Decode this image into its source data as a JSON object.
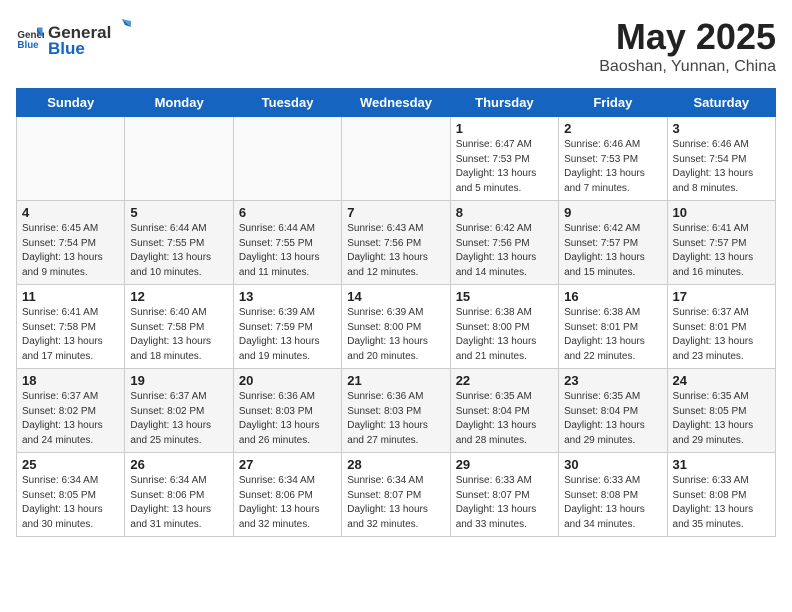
{
  "header": {
    "logo_general": "General",
    "logo_blue": "Blue",
    "month": "May 2025",
    "location": "Baoshan, Yunnan, China"
  },
  "weekdays": [
    "Sunday",
    "Monday",
    "Tuesday",
    "Wednesday",
    "Thursday",
    "Friday",
    "Saturday"
  ],
  "weeks": [
    [
      {
        "day": "",
        "info": ""
      },
      {
        "day": "",
        "info": ""
      },
      {
        "day": "",
        "info": ""
      },
      {
        "day": "",
        "info": ""
      },
      {
        "day": "1",
        "info": "Sunrise: 6:47 AM\nSunset: 7:53 PM\nDaylight: 13 hours and 5 minutes."
      },
      {
        "day": "2",
        "info": "Sunrise: 6:46 AM\nSunset: 7:53 PM\nDaylight: 13 hours and 7 minutes."
      },
      {
        "day": "3",
        "info": "Sunrise: 6:46 AM\nSunset: 7:54 PM\nDaylight: 13 hours and 8 minutes."
      }
    ],
    [
      {
        "day": "4",
        "info": "Sunrise: 6:45 AM\nSunset: 7:54 PM\nDaylight: 13 hours and 9 minutes."
      },
      {
        "day": "5",
        "info": "Sunrise: 6:44 AM\nSunset: 7:55 PM\nDaylight: 13 hours and 10 minutes."
      },
      {
        "day": "6",
        "info": "Sunrise: 6:44 AM\nSunset: 7:55 PM\nDaylight: 13 hours and 11 minutes."
      },
      {
        "day": "7",
        "info": "Sunrise: 6:43 AM\nSunset: 7:56 PM\nDaylight: 13 hours and 12 minutes."
      },
      {
        "day": "8",
        "info": "Sunrise: 6:42 AM\nSunset: 7:56 PM\nDaylight: 13 hours and 14 minutes."
      },
      {
        "day": "9",
        "info": "Sunrise: 6:42 AM\nSunset: 7:57 PM\nDaylight: 13 hours and 15 minutes."
      },
      {
        "day": "10",
        "info": "Sunrise: 6:41 AM\nSunset: 7:57 PM\nDaylight: 13 hours and 16 minutes."
      }
    ],
    [
      {
        "day": "11",
        "info": "Sunrise: 6:41 AM\nSunset: 7:58 PM\nDaylight: 13 hours and 17 minutes."
      },
      {
        "day": "12",
        "info": "Sunrise: 6:40 AM\nSunset: 7:58 PM\nDaylight: 13 hours and 18 minutes."
      },
      {
        "day": "13",
        "info": "Sunrise: 6:39 AM\nSunset: 7:59 PM\nDaylight: 13 hours and 19 minutes."
      },
      {
        "day": "14",
        "info": "Sunrise: 6:39 AM\nSunset: 8:00 PM\nDaylight: 13 hours and 20 minutes."
      },
      {
        "day": "15",
        "info": "Sunrise: 6:38 AM\nSunset: 8:00 PM\nDaylight: 13 hours and 21 minutes."
      },
      {
        "day": "16",
        "info": "Sunrise: 6:38 AM\nSunset: 8:01 PM\nDaylight: 13 hours and 22 minutes."
      },
      {
        "day": "17",
        "info": "Sunrise: 6:37 AM\nSunset: 8:01 PM\nDaylight: 13 hours and 23 minutes."
      }
    ],
    [
      {
        "day": "18",
        "info": "Sunrise: 6:37 AM\nSunset: 8:02 PM\nDaylight: 13 hours and 24 minutes."
      },
      {
        "day": "19",
        "info": "Sunrise: 6:37 AM\nSunset: 8:02 PM\nDaylight: 13 hours and 25 minutes."
      },
      {
        "day": "20",
        "info": "Sunrise: 6:36 AM\nSunset: 8:03 PM\nDaylight: 13 hours and 26 minutes."
      },
      {
        "day": "21",
        "info": "Sunrise: 6:36 AM\nSunset: 8:03 PM\nDaylight: 13 hours and 27 minutes."
      },
      {
        "day": "22",
        "info": "Sunrise: 6:35 AM\nSunset: 8:04 PM\nDaylight: 13 hours and 28 minutes."
      },
      {
        "day": "23",
        "info": "Sunrise: 6:35 AM\nSunset: 8:04 PM\nDaylight: 13 hours and 29 minutes."
      },
      {
        "day": "24",
        "info": "Sunrise: 6:35 AM\nSunset: 8:05 PM\nDaylight: 13 hours and 29 minutes."
      }
    ],
    [
      {
        "day": "25",
        "info": "Sunrise: 6:34 AM\nSunset: 8:05 PM\nDaylight: 13 hours and 30 minutes."
      },
      {
        "day": "26",
        "info": "Sunrise: 6:34 AM\nSunset: 8:06 PM\nDaylight: 13 hours and 31 minutes."
      },
      {
        "day": "27",
        "info": "Sunrise: 6:34 AM\nSunset: 8:06 PM\nDaylight: 13 hours and 32 minutes."
      },
      {
        "day": "28",
        "info": "Sunrise: 6:34 AM\nSunset: 8:07 PM\nDaylight: 13 hours and 32 minutes."
      },
      {
        "day": "29",
        "info": "Sunrise: 6:33 AM\nSunset: 8:07 PM\nDaylight: 13 hours and 33 minutes."
      },
      {
        "day": "30",
        "info": "Sunrise: 6:33 AM\nSunset: 8:08 PM\nDaylight: 13 hours and 34 minutes."
      },
      {
        "day": "31",
        "info": "Sunrise: 6:33 AM\nSunset: 8:08 PM\nDaylight: 13 hours and 35 minutes."
      }
    ]
  ]
}
